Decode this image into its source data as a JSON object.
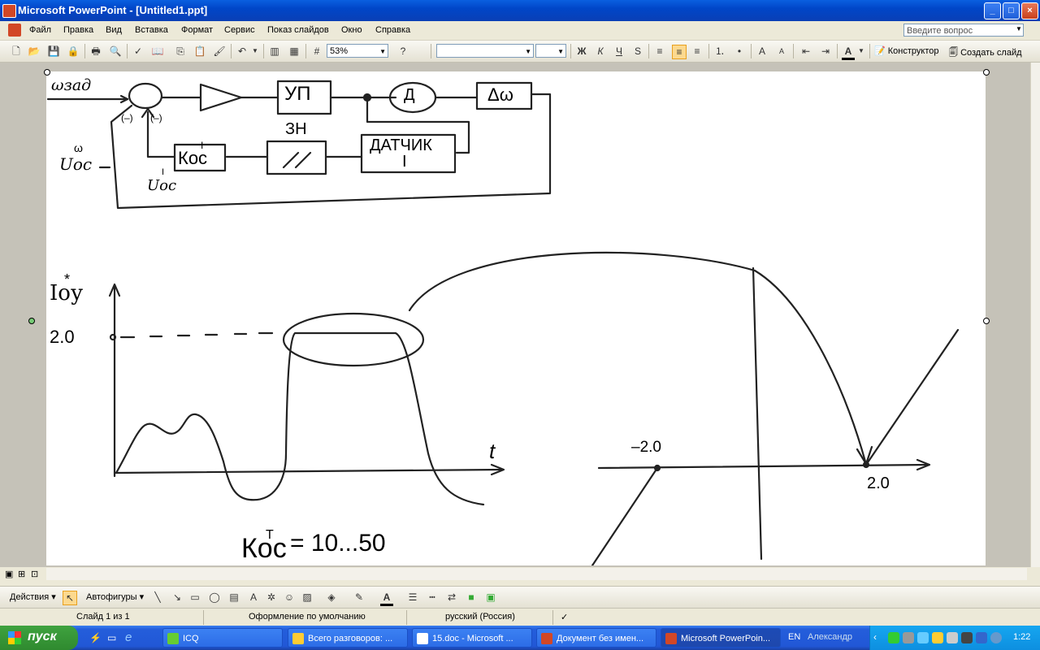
{
  "window": {
    "title": "Microsoft PowerPoint - [Untitled1.ppt]",
    "minimize": "_",
    "maximize": "□",
    "close": "×"
  },
  "menu": {
    "items": [
      "Файл",
      "Правка",
      "Вид",
      "Вставка",
      "Формат",
      "Сервис",
      "Показ слайдов",
      "Окно",
      "Справка"
    ],
    "help_placeholder": "Введите вопрос"
  },
  "toolbar": {
    "zoom": "53%",
    "bold": "Ж",
    "italic": "К",
    "underline": "Ч",
    "shadow": "S",
    "designer": "Конструктор",
    "new_slide": "Создать слайд"
  },
  "slide": {
    "block_labels": {
      "omega_ref": "ωзад",
      "amp_up": "УП",
      "motor": "Д",
      "delta_omega": "Δω",
      "k_oc": "Кос",
      "k_oc_sup": "I",
      "zn": "ЗН",
      "sensor_line1": "ДАТЧИК",
      "sensor_line2": "I",
      "minus1": "(–)",
      "minus2": "(–)",
      "u_oc_omega": "Uос",
      "u_oc_omega_sup": "ω",
      "u_oc_i": "Uос",
      "u_oc_i_sup": "I"
    },
    "plot": {
      "y_label": "Iоу",
      "y_label_sup": "*",
      "y_tick": "2.0",
      "x_label": "t",
      "right_neg": "–2.0",
      "right_pos": "2.0",
      "formula": "Кос",
      "formula_sup": "Т",
      "formula_val": "= 10...50"
    }
  },
  "drawing_toolbar": {
    "actions": "Действия",
    "autoshapes": "Автофигуры"
  },
  "status": {
    "slide": "Слайд 1 из 1",
    "design": "Оформление по умолчанию",
    "language": "русский (Россия)"
  },
  "taskbar": {
    "start": "пуск",
    "tasks": [
      "ICQ",
      "Всего разговоров: ...",
      "15.doc - Microsoft ...",
      "Документ без имен...",
      "Microsoft PowerPoin..."
    ],
    "lang": "EN",
    "user": "Александр",
    "clock": "1:22"
  }
}
